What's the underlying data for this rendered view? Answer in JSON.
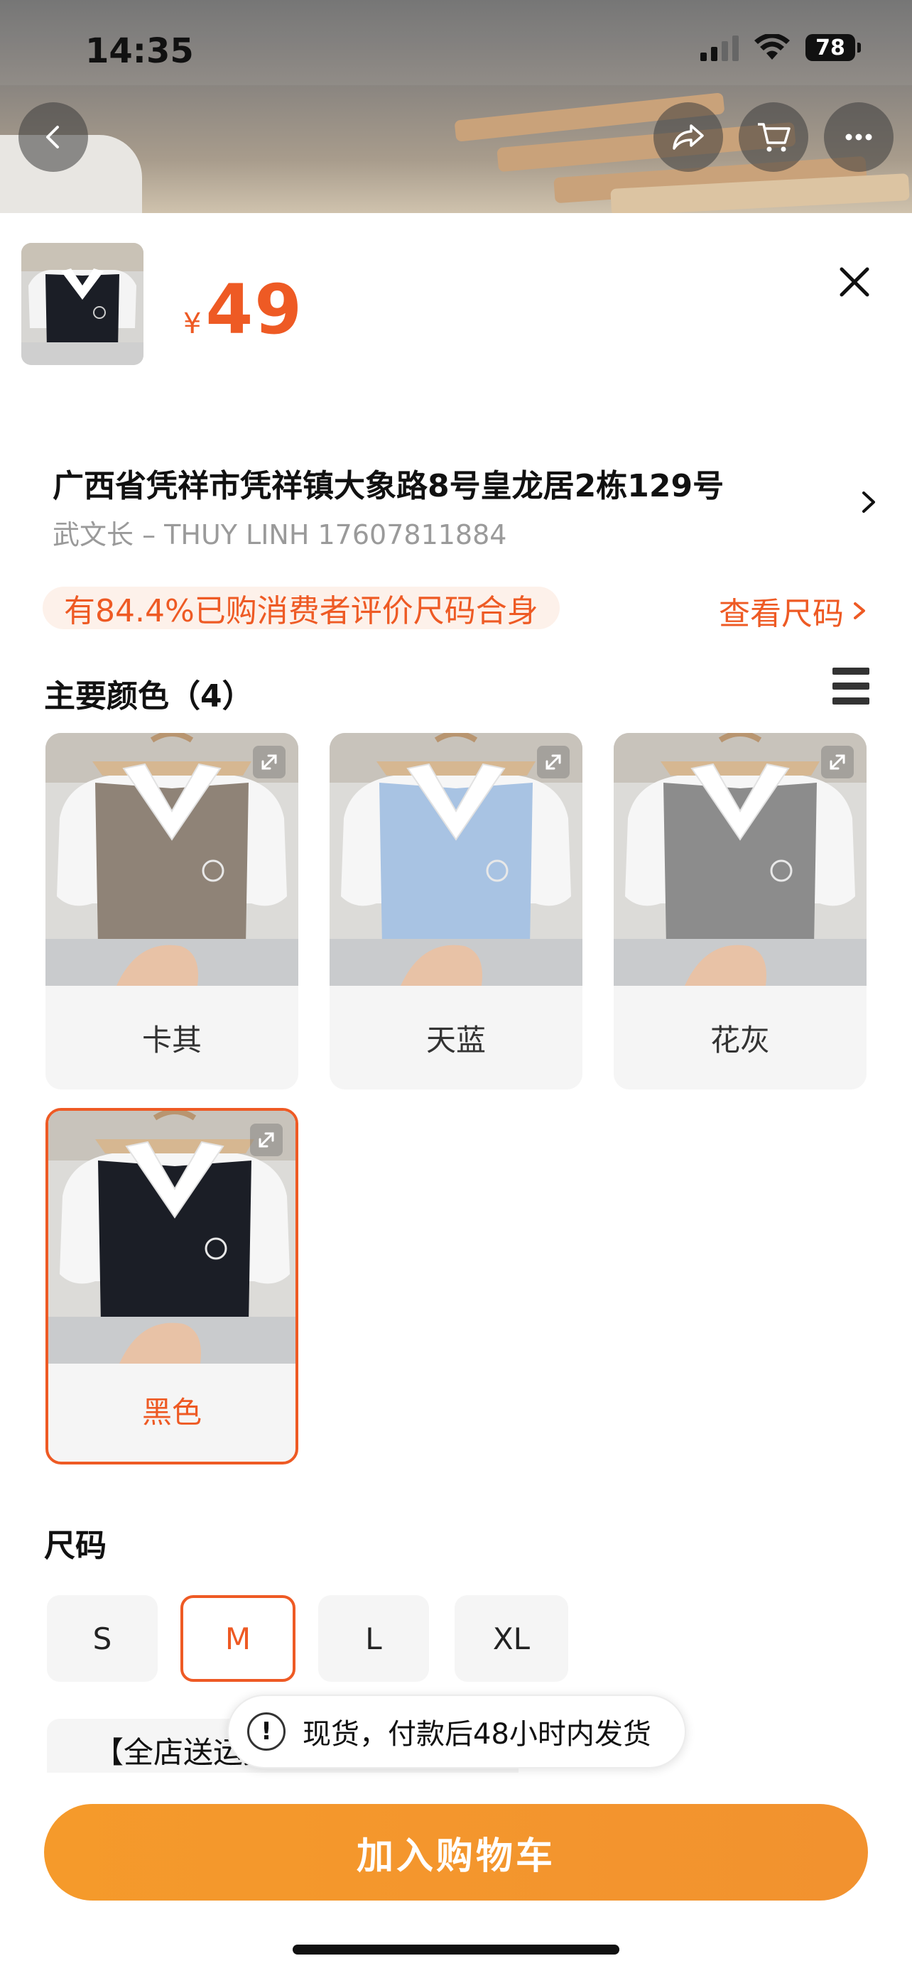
{
  "status": {
    "time": "14:35",
    "battery": "78"
  },
  "product": {
    "currency": "¥",
    "price": "49"
  },
  "address": {
    "line": "广西省凭祥市凭祥镇大象路8号皇龙居2栋129号",
    "contact": "武文长 – THUY LINH 17607811884"
  },
  "fit": {
    "badge": "有84.4%已购消费者评价尺码合身",
    "size_chart_link": "查看尺码"
  },
  "colors": {
    "title": "主要颜色（4）",
    "items": [
      {
        "label": "卡其",
        "vest_color": "#8f8377"
      },
      {
        "label": "天蓝",
        "vest_color": "#a8c3e3"
      },
      {
        "label": "花灰",
        "vest_color": "#8c8c8c"
      },
      {
        "label": "黑色",
        "vest_color": "#1b1e26",
        "selected": true
      }
    ]
  },
  "sizes": {
    "title": "尺码",
    "items": [
      {
        "label": "S"
      },
      {
        "label": "M",
        "selected": true
      },
      {
        "label": "L"
      },
      {
        "label": "XL"
      }
    ]
  },
  "promo": {
    "text": "【全店送运费险  赠送好礼】"
  },
  "toast": {
    "text": "现货，付款后48小时内发货"
  },
  "cta": {
    "add_to_cart": "加入购物车"
  },
  "theme": {
    "accent": "#ee5a24",
    "cta": "#f2922f"
  }
}
